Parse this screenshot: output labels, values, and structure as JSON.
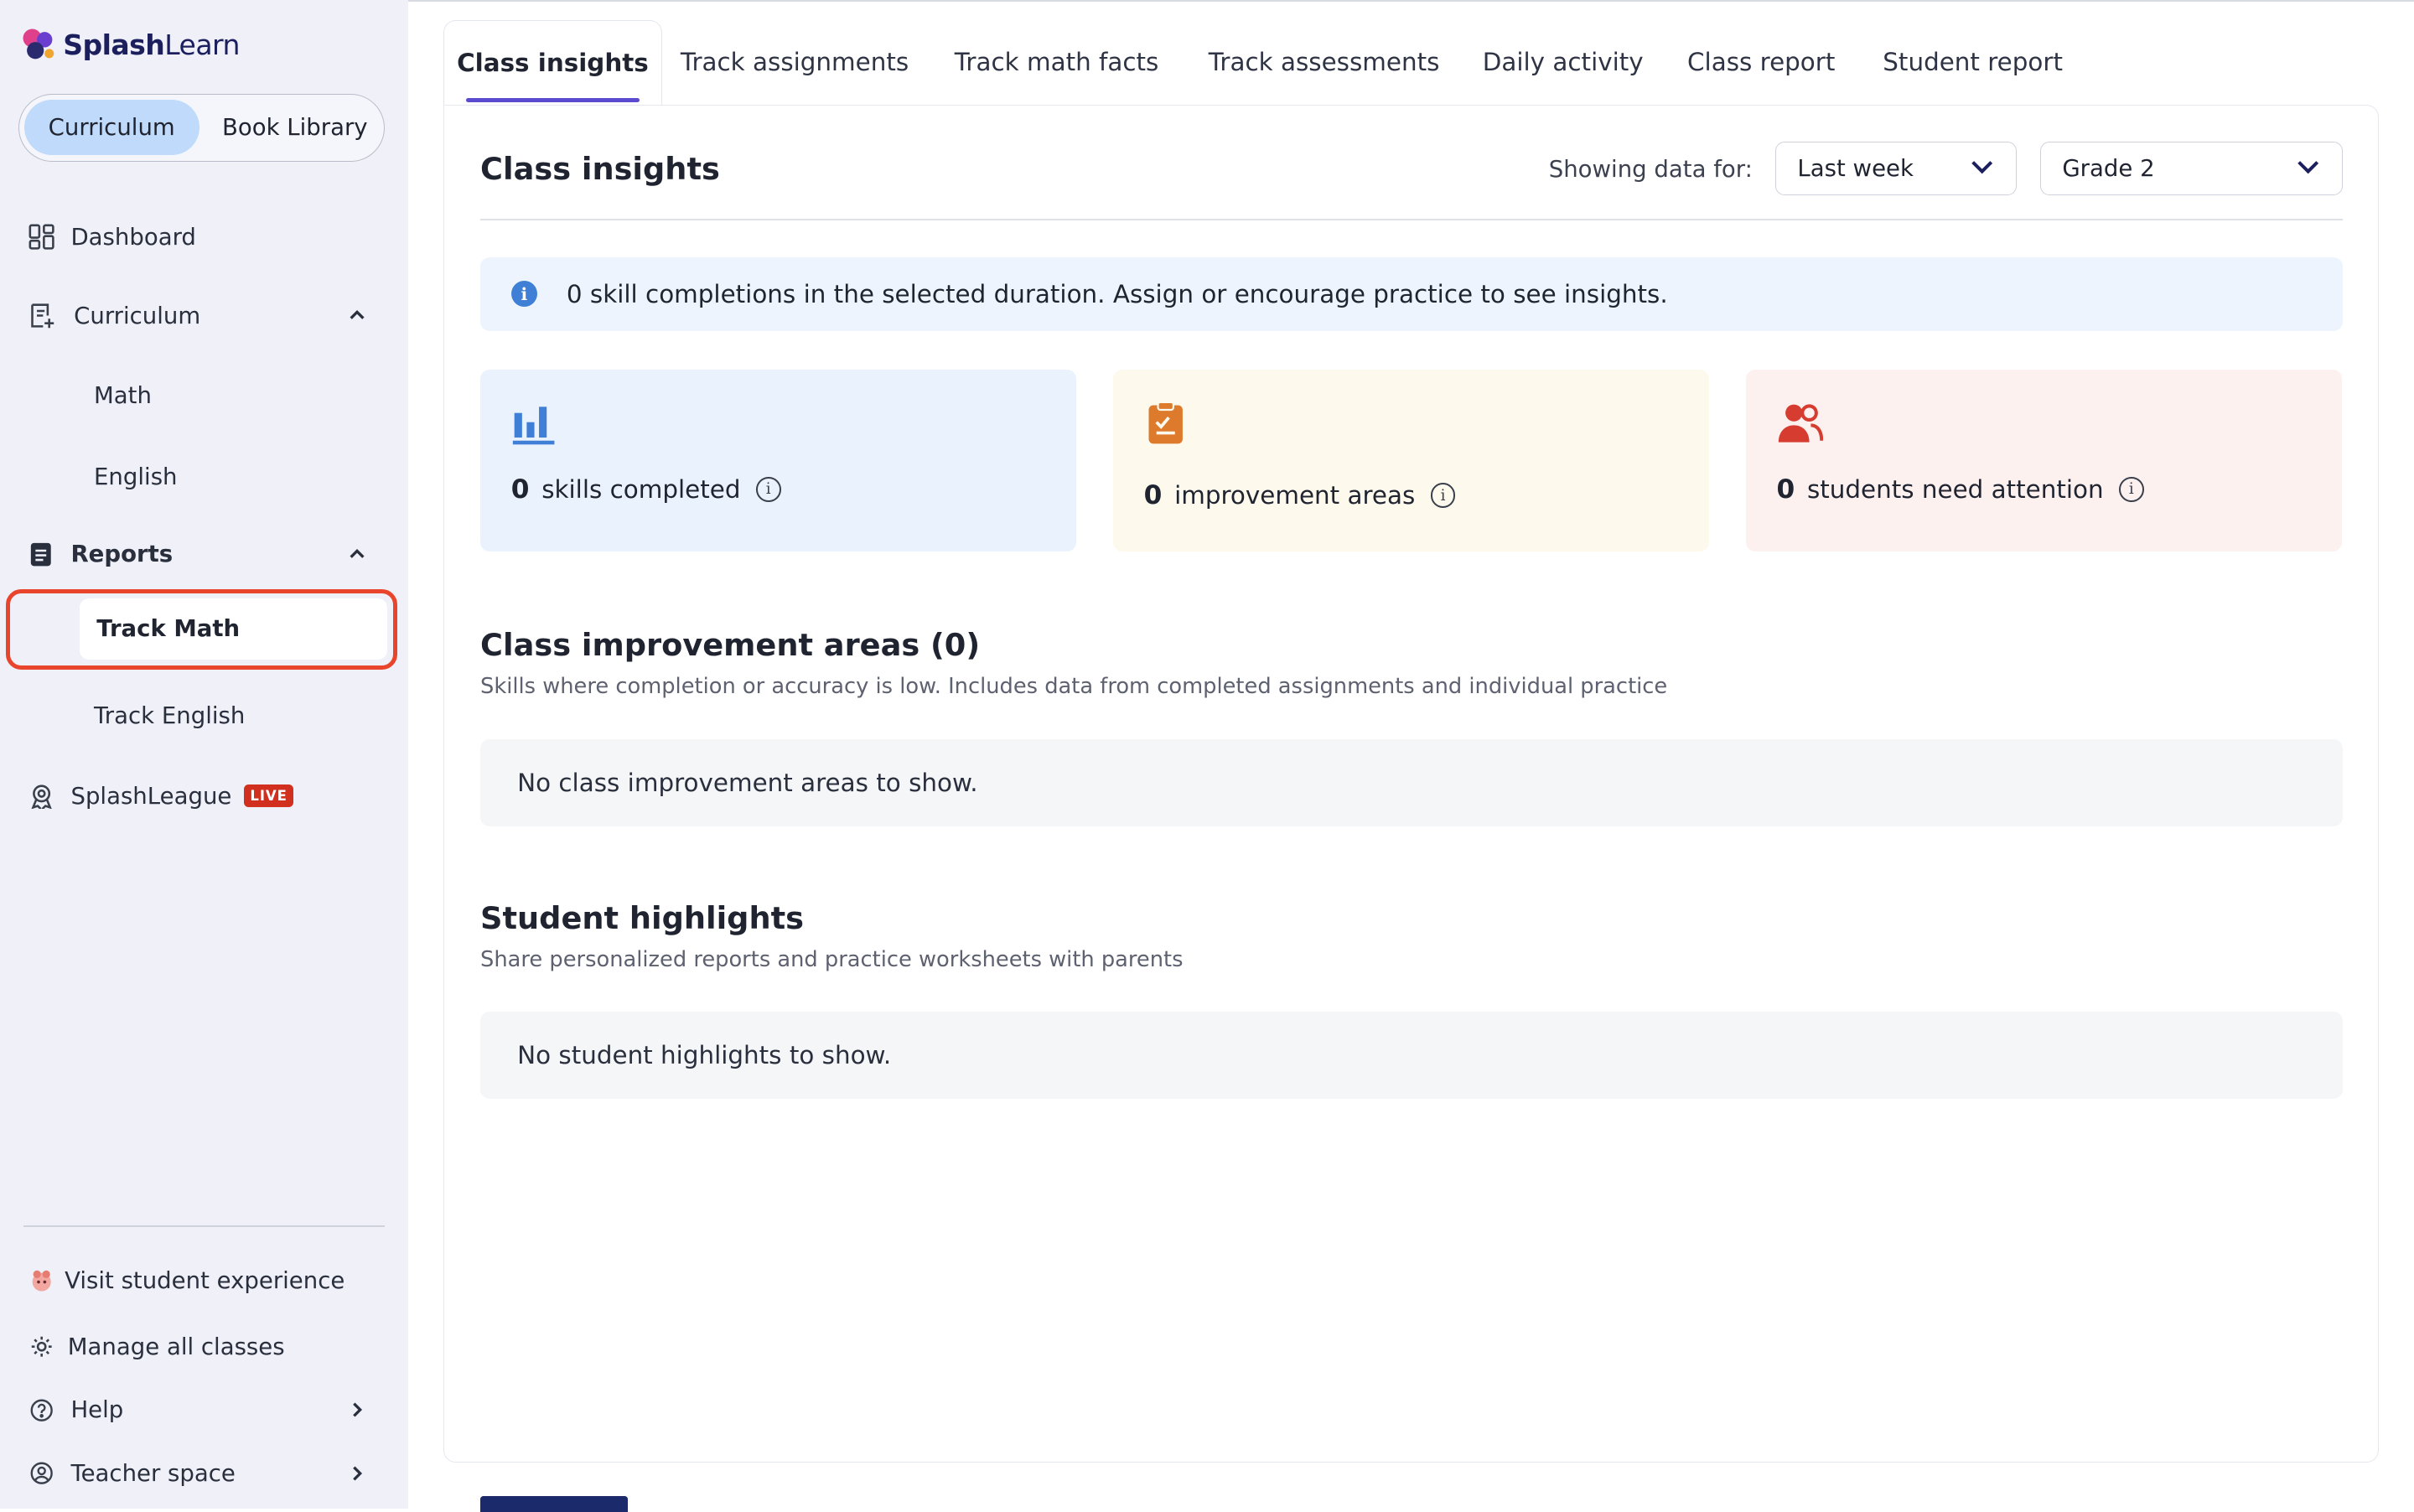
{
  "brand": {
    "name_bold": "Splash",
    "name_regular": "Learn"
  },
  "mode_toggle": {
    "active": "Curriculum",
    "other": "Book Library"
  },
  "sidebar": {
    "dashboard": "Dashboard",
    "curriculum": "Curriculum",
    "curriculum_sub": [
      "Math",
      "English"
    ],
    "reports": "Reports",
    "reports_sub": [
      "Track Math",
      "Track English"
    ],
    "splashleague": "SplashLeague",
    "live_badge": "LIVE",
    "bottom": {
      "visit_student": "Visit student experience",
      "manage_classes": "Manage all classes",
      "help": "Help",
      "teacher_space": "Teacher space"
    }
  },
  "tabs": [
    "Class insights",
    "Track assignments",
    "Track math facts",
    "Track assessments",
    "Daily activity",
    "Class report",
    "Student report"
  ],
  "main": {
    "title": "Class insights",
    "showing_label": "Showing data for:",
    "period_select": "Last week",
    "grade_select": "Grade 2",
    "info_icon": "i",
    "info_banner": "0 skill completions in the selected duration. Assign or encourage practice to see insights.",
    "stats": [
      {
        "value": "0",
        "label": "skills completed",
        "icon": "bar-chart-icon",
        "bg": "#eaf3fd",
        "color": "#3f7fd6"
      },
      {
        "value": "0",
        "label": "improvement areas",
        "icon": "clipboard-icon",
        "bg": "#fdf9ec",
        "color": "#dd7a2c"
      },
      {
        "value": "0",
        "label": "students need attention",
        "icon": "users-icon",
        "bg": "#fdf1f0",
        "color": "#d63c2f"
      }
    ],
    "info_glyph": "i",
    "improvement": {
      "title": "Class improvement areas (0)",
      "subtitle": "Skills where completion or accuracy is low. Includes data from completed assignments and individual practice",
      "empty": "No class improvement areas to show."
    },
    "highlights": {
      "title": "Student highlights",
      "subtitle": "Share personalized reports and practice worksheets with parents",
      "empty": "No student highlights to show."
    }
  },
  "colors": {
    "accent": "#5a4bd0",
    "selection_outline": "#e8452c",
    "sidebar_bg": "#eff0f8",
    "toggle_active": "#bfdafa"
  }
}
